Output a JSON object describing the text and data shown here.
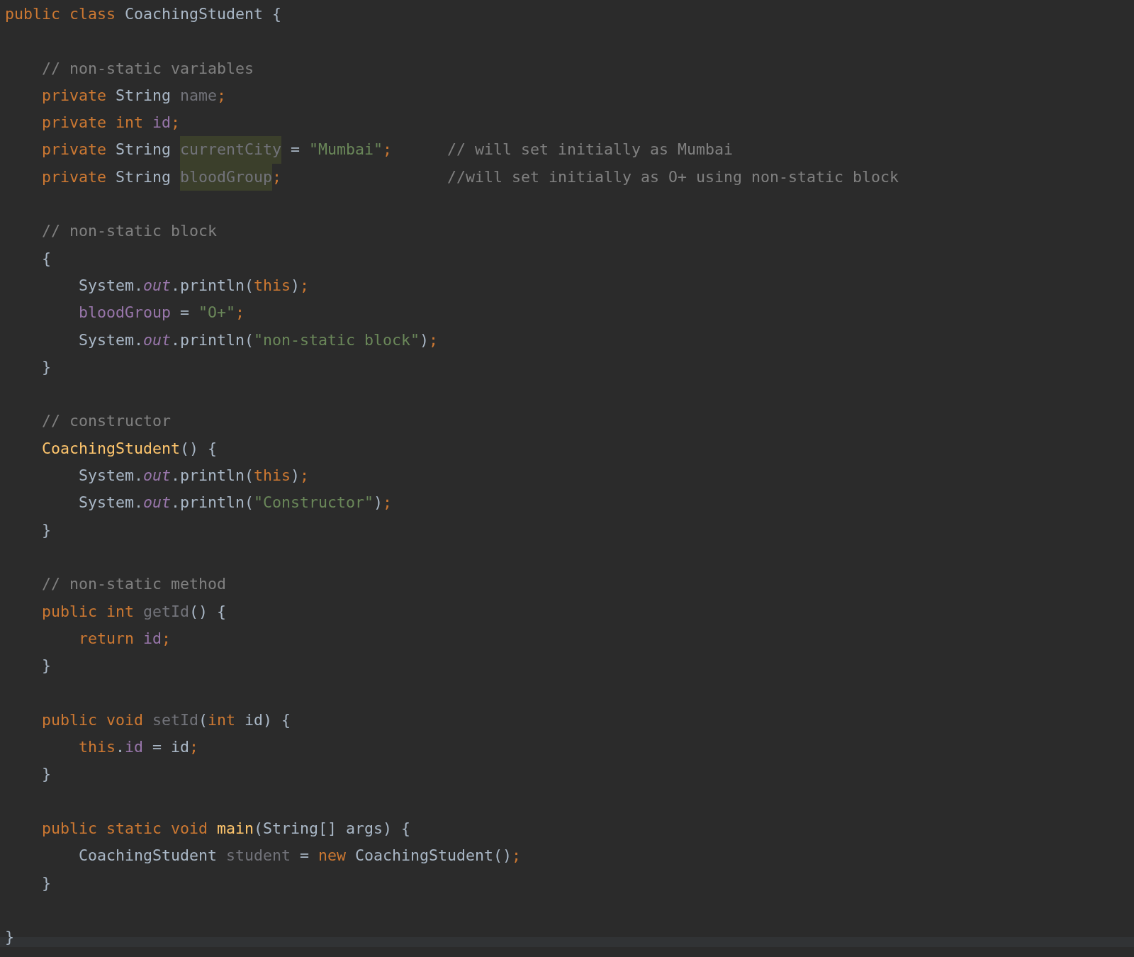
{
  "editor": {
    "lines": [
      {
        "kind": "code",
        "tokens": [
          {
            "t": "public class ",
            "kind": "keyword"
          },
          {
            "t": "CoachingStudent {",
            "kind": "plain"
          }
        ]
      },
      {
        "kind": "blank"
      },
      {
        "kind": "code",
        "tokens": [
          {
            "t": "    // non-static variables",
            "kind": "comment"
          }
        ]
      },
      {
        "kind": "code",
        "tokens": [
          {
            "t": "    private ",
            "kind": "keyword"
          },
          {
            "t": "String ",
            "kind": "plain"
          },
          {
            "t": "name",
            "kind": "unused"
          },
          {
            "t": ";",
            "kind": "keyword"
          }
        ]
      },
      {
        "kind": "code",
        "tokens": [
          {
            "t": "    private int ",
            "kind": "keyword"
          },
          {
            "t": "id",
            "kind": "field"
          },
          {
            "t": ";",
            "kind": "keyword"
          }
        ]
      },
      {
        "kind": "code",
        "tokens": [
          {
            "t": "    private ",
            "kind": "keyword"
          },
          {
            "t": "String ",
            "kind": "plain"
          },
          {
            "t": "currentCity",
            "kind": "marked"
          },
          {
            "t": " = ",
            "kind": "plain"
          },
          {
            "t": "\"Mumbai\"",
            "kind": "string"
          },
          {
            "t": ";",
            "kind": "keyword"
          },
          {
            "t": "      // will set initially as Mumbai",
            "kind": "comment"
          }
        ]
      },
      {
        "kind": "code",
        "tokens": [
          {
            "t": "    private ",
            "kind": "keyword"
          },
          {
            "t": "String ",
            "kind": "plain"
          },
          {
            "t": "bloodGroup",
            "kind": "marked"
          },
          {
            "t": ";",
            "kind": "keyword"
          },
          {
            "t": "                  //will set initially as O+ using non-static block",
            "kind": "comment"
          }
        ]
      },
      {
        "kind": "blank"
      },
      {
        "kind": "code",
        "tokens": [
          {
            "t": "    // non-static block",
            "kind": "comment"
          }
        ]
      },
      {
        "kind": "code",
        "tokens": [
          {
            "t": "    {",
            "kind": "plain"
          }
        ]
      },
      {
        "kind": "code",
        "tokens": [
          {
            "t": "        System.",
            "kind": "plain"
          },
          {
            "t": "out",
            "kind": "static"
          },
          {
            "t": ".println(",
            "kind": "plain"
          },
          {
            "t": "this",
            "kind": "keyword"
          },
          {
            "t": ")",
            "kind": "plain"
          },
          {
            "t": ";",
            "kind": "keyword"
          }
        ]
      },
      {
        "kind": "code",
        "tokens": [
          {
            "t": "        bloodGroup",
            "kind": "field"
          },
          {
            "t": " = ",
            "kind": "plain"
          },
          {
            "t": "\"O+\"",
            "kind": "string"
          },
          {
            "t": ";",
            "kind": "keyword"
          }
        ]
      },
      {
        "kind": "code",
        "tokens": [
          {
            "t": "        System.",
            "kind": "plain"
          },
          {
            "t": "out",
            "kind": "static"
          },
          {
            "t": ".println(",
            "kind": "plain"
          },
          {
            "t": "\"non-static block\"",
            "kind": "string"
          },
          {
            "t": ")",
            "kind": "plain"
          },
          {
            "t": ";",
            "kind": "keyword"
          }
        ]
      },
      {
        "kind": "code",
        "tokens": [
          {
            "t": "    }",
            "kind": "plain"
          }
        ]
      },
      {
        "kind": "blank"
      },
      {
        "kind": "code",
        "tokens": [
          {
            "t": "    // constructor",
            "kind": "comment"
          }
        ]
      },
      {
        "kind": "code",
        "tokens": [
          {
            "t": "    CoachingStudent",
            "kind": "method"
          },
          {
            "t": "() {",
            "kind": "plain"
          }
        ]
      },
      {
        "kind": "code",
        "tokens": [
          {
            "t": "        System.",
            "kind": "plain"
          },
          {
            "t": "out",
            "kind": "static"
          },
          {
            "t": ".println(",
            "kind": "plain"
          },
          {
            "t": "this",
            "kind": "keyword"
          },
          {
            "t": ")",
            "kind": "plain"
          },
          {
            "t": ";",
            "kind": "keyword"
          }
        ]
      },
      {
        "kind": "code",
        "tokens": [
          {
            "t": "        System.",
            "kind": "plain"
          },
          {
            "t": "out",
            "kind": "static"
          },
          {
            "t": ".println(",
            "kind": "plain"
          },
          {
            "t": "\"Constructor\"",
            "kind": "string"
          },
          {
            "t": ")",
            "kind": "plain"
          },
          {
            "t": ";",
            "kind": "keyword"
          }
        ]
      },
      {
        "kind": "code",
        "tokens": [
          {
            "t": "    }",
            "kind": "plain"
          }
        ]
      },
      {
        "kind": "blank"
      },
      {
        "kind": "code",
        "tokens": [
          {
            "t": "    // non-static method",
            "kind": "comment"
          }
        ]
      },
      {
        "kind": "code",
        "tokens": [
          {
            "t": "    public int ",
            "kind": "keyword"
          },
          {
            "t": "getId",
            "kind": "unused"
          },
          {
            "t": "() {",
            "kind": "plain"
          }
        ]
      },
      {
        "kind": "code",
        "tokens": [
          {
            "t": "        return ",
            "kind": "keyword"
          },
          {
            "t": "id",
            "kind": "field"
          },
          {
            "t": ";",
            "kind": "keyword"
          }
        ]
      },
      {
        "kind": "code",
        "tokens": [
          {
            "t": "    }",
            "kind": "plain"
          }
        ]
      },
      {
        "kind": "blank"
      },
      {
        "kind": "code",
        "tokens": [
          {
            "t": "    public void ",
            "kind": "keyword"
          },
          {
            "t": "setId",
            "kind": "unused"
          },
          {
            "t": "(",
            "kind": "plain"
          },
          {
            "t": "int",
            "kind": "keyword"
          },
          {
            "t": " id) {",
            "kind": "plain"
          }
        ]
      },
      {
        "kind": "code",
        "tokens": [
          {
            "t": "        this",
            "kind": "keyword"
          },
          {
            "t": ".",
            "kind": "plain"
          },
          {
            "t": "id",
            "kind": "field"
          },
          {
            "t": " = id",
            "kind": "plain"
          },
          {
            "t": ";",
            "kind": "keyword"
          }
        ]
      },
      {
        "kind": "code",
        "tokens": [
          {
            "t": "    }",
            "kind": "plain"
          }
        ]
      },
      {
        "kind": "blank"
      },
      {
        "kind": "code",
        "tokens": [
          {
            "t": "    public static void ",
            "kind": "keyword"
          },
          {
            "t": "main",
            "kind": "method"
          },
          {
            "t": "(String[] args) {",
            "kind": "plain"
          }
        ]
      },
      {
        "kind": "code",
        "tokens": [
          {
            "t": "        CoachingStudent ",
            "kind": "plain"
          },
          {
            "t": "student",
            "kind": "unused"
          },
          {
            "t": " = ",
            "kind": "plain"
          },
          {
            "t": "new ",
            "kind": "keyword"
          },
          {
            "t": "CoachingStudent()",
            "kind": "plain"
          },
          {
            "t": ";",
            "kind": "keyword"
          }
        ]
      },
      {
        "kind": "code",
        "tokens": [
          {
            "t": "    }",
            "kind": "plain"
          }
        ]
      },
      {
        "kind": "blank"
      },
      {
        "kind": "code",
        "tokens": [
          {
            "t": "}",
            "kind": "plain"
          }
        ]
      }
    ]
  }
}
